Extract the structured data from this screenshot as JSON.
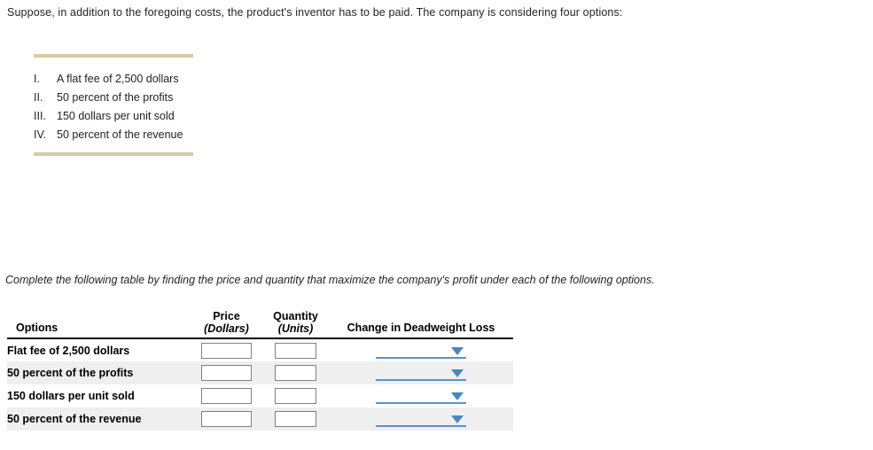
{
  "intro": {
    "text": "Suppose, in addition to the foregoing costs, the product's inventor has to be paid. The company is considering four options:"
  },
  "options_block": {
    "items": [
      {
        "numeral": "I.",
        "label": "A flat fee of 2,500 dollars"
      },
      {
        "numeral": "II.",
        "label": "50 percent of the profits"
      },
      {
        "numeral": "III.",
        "label": "150 dollars per unit sold"
      },
      {
        "numeral": "IV.",
        "label": "50 percent of the revenue"
      }
    ],
    "rule_color": "#d6cca0"
  },
  "instruction": {
    "text": "Complete the following table by finding the price and quantity that maximize the company's profit under each of the following options."
  },
  "table": {
    "headers": {
      "options": "Options",
      "price_main": "Price",
      "price_unit": "(Dollars)",
      "quantity_main": "Quantity",
      "quantity_unit": "(Units)",
      "dwl": "Change in Deadweight Loss"
    },
    "rows": [
      {
        "option": "Flat fee of 2,500 dollars",
        "price": "",
        "quantity": "",
        "dwl": ""
      },
      {
        "option": "50 percent of the profits",
        "price": "",
        "quantity": "",
        "dwl": ""
      },
      {
        "option": "150 dollars per unit sold",
        "price": "",
        "quantity": "",
        "dwl": ""
      },
      {
        "option": "50 percent of the revenue",
        "price": "",
        "quantity": "",
        "dwl": ""
      }
    ],
    "input_placeholder": "",
    "dropdown_value": "",
    "accent_color": "#4a87bd",
    "alt_row_color": "#efefef"
  }
}
